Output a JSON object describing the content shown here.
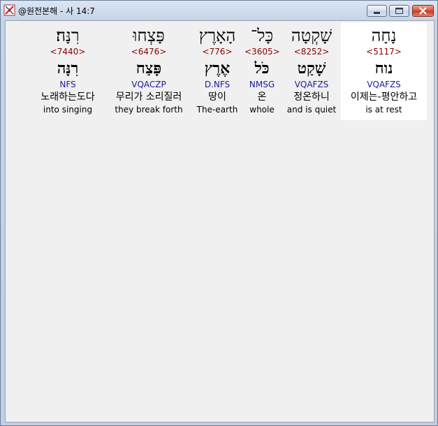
{
  "window": {
    "title": "@원전본해 - 사 14:7",
    "controls": {
      "minimize": "minimize-icon",
      "maximize": "maximize-icon",
      "close": "close-icon"
    }
  },
  "words": [
    {
      "hebrew": "נָחָה",
      "strong": "<5117>",
      "lemma": "נוח",
      "parse": "VQAFZS",
      "korean": "이제는-평안하고",
      "english": "is at rest",
      "selected": true
    },
    {
      "hebrew": "שָׁקְטָה",
      "strong": "<8252>",
      "lemma": "שָׁקַט",
      "parse": "VQAFZS",
      "korean": "정온하니",
      "english": "and is quiet",
      "selected": false
    },
    {
      "hebrew": "כָּל־",
      "strong": "<3605>",
      "lemma": "כֹּל",
      "parse": "NMSG",
      "korean": "온",
      "english": "whole",
      "selected": false
    },
    {
      "hebrew": "הָאָרֶץ",
      "strong": "<776>",
      "lemma": "אֶרֶץ",
      "parse": "D.NFS",
      "korean": "땅이",
      "english": "The-earth",
      "selected": false
    },
    {
      "hebrew": "פָּצְחוּ",
      "strong": "<6476>",
      "lemma": "פָּצַח",
      "parse": "VQACZP",
      "korean": "무리가 소리질러",
      "english": "they break forth",
      "selected": false
    },
    {
      "hebrew": "רִנָּה׃",
      "strong": "<7440>",
      "lemma": "רִנָּה",
      "parse": "NFS",
      "korean": "노래하는도다",
      "english": "into singing",
      "selected": false
    }
  ],
  "colors": {
    "strong_number": "#8b0000",
    "parse_code": "#1a1aa0",
    "selected_background": "#ffffff",
    "client_background": "#f0f0f0"
  }
}
